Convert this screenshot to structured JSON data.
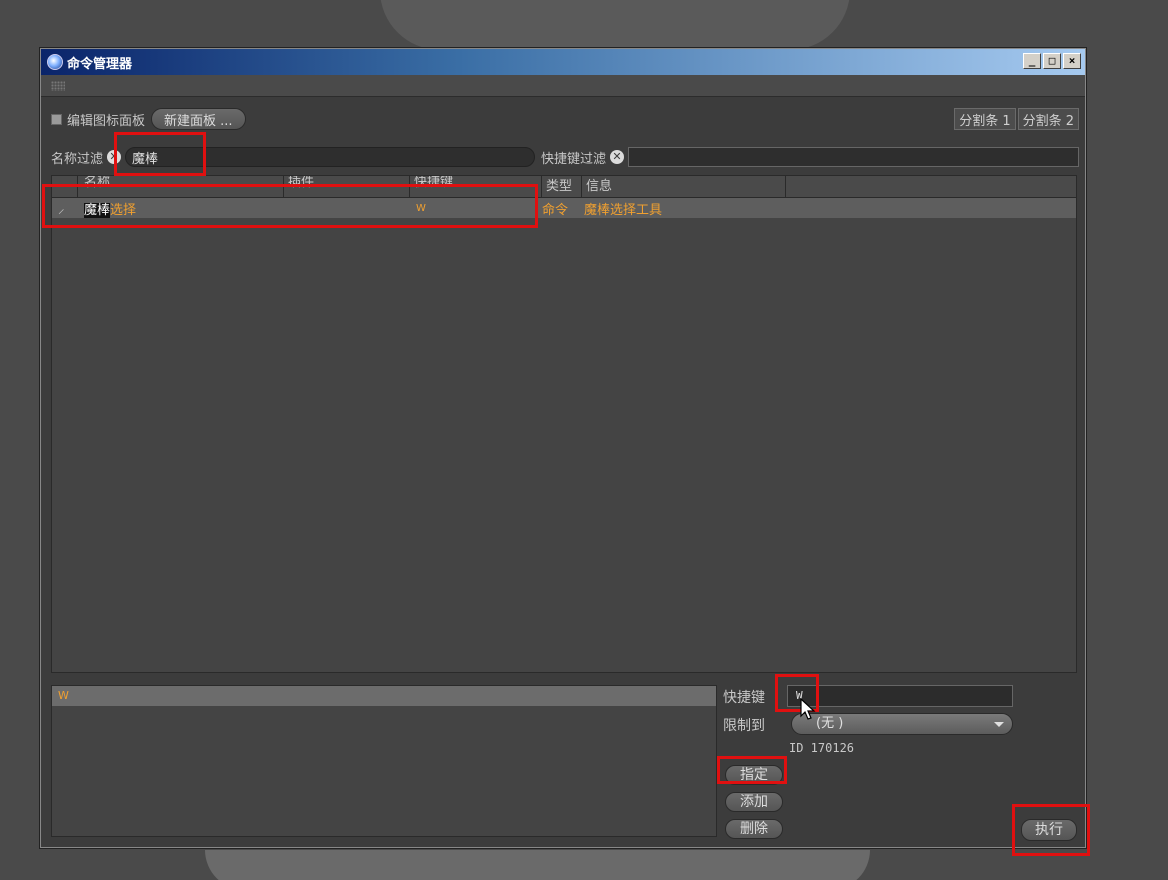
{
  "window": {
    "title": "命令管理器",
    "controls": [
      "_",
      "□",
      "×"
    ]
  },
  "toolbar": {
    "edit_icon_panel_label": "编辑图标面板",
    "new_panel_button": "新建面板 ...",
    "split1": "分割条 1",
    "split2": "分割条 2"
  },
  "filters": {
    "name_label": "名称过滤",
    "name_value": "魔棒",
    "shortcut_label": "快捷键过滤",
    "shortcut_value": ""
  },
  "list": {
    "columns": [
      "名称",
      "插件",
      "快捷键",
      "类型",
      "信息"
    ],
    "rows": [
      {
        "name_highlight": "魔棒",
        "name_rest": "选择",
        "plugin": "",
        "shortcut": "W",
        "type": "命令",
        "info": "魔棒选择工具"
      }
    ]
  },
  "bottom": {
    "selected_shortcut": "W",
    "shortcut_label": "快捷键",
    "shortcut_value": "W",
    "restrict_label": "限制到",
    "restrict_value": "(无 )",
    "id_text": "ID 170126",
    "assign_button": "指定",
    "add_button": "添加",
    "delete_button": "删除",
    "execute_button": "执行"
  },
  "colors": {
    "highlight_orange": "#f0a030",
    "annotation_red": "#e01010",
    "title_blue": "#0a246a"
  }
}
